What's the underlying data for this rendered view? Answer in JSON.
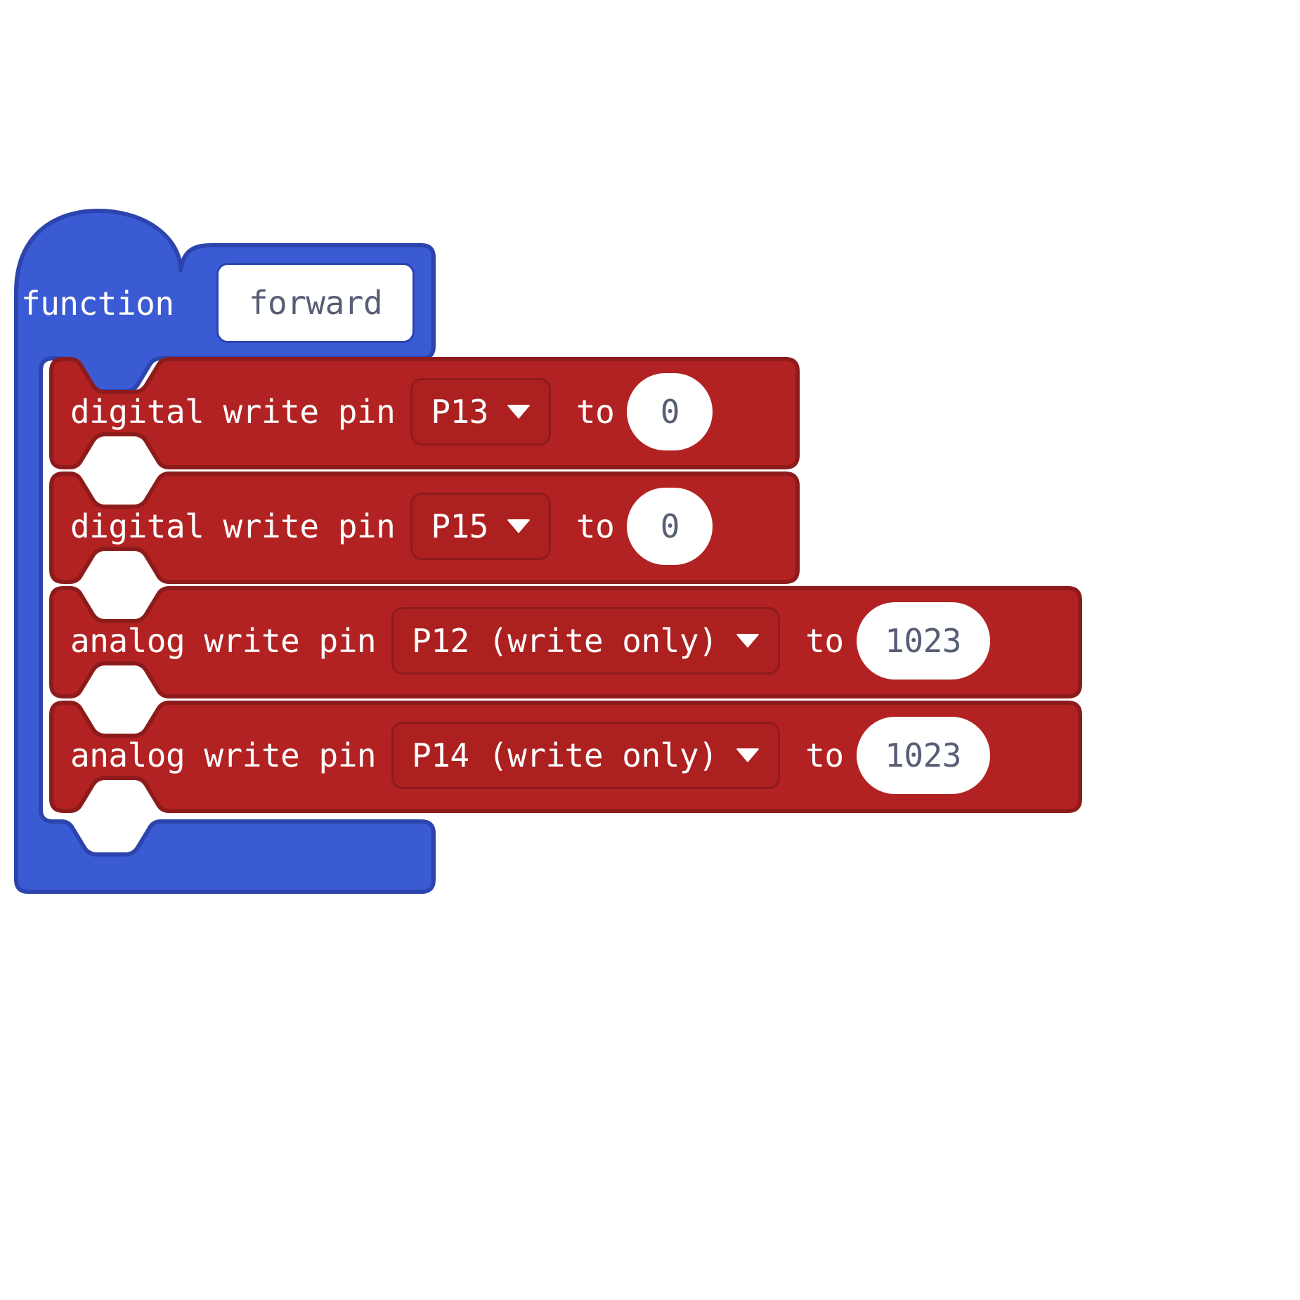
{
  "colors": {
    "function_fill": "#3b5bd4",
    "function_stroke": "#2c44ad",
    "statement_fill": "#b32222",
    "statement_stroke": "#8e1b1b",
    "field_text": "#575e75",
    "label_text": "#ffffff",
    "canvas": "#ffffff"
  },
  "function_block": {
    "keyword": "function",
    "name_field": {
      "value": "forward",
      "placeholder": "function name"
    }
  },
  "statements": [
    {
      "index": 0,
      "kind": "digital-write",
      "label": "digital write pin",
      "pin_dropdown": {
        "value": "P13",
        "caret_icon": "chevron-down-icon"
      },
      "connector": "to",
      "value_field": {
        "value": "0",
        "size": "narrow"
      }
    },
    {
      "index": 1,
      "kind": "digital-write",
      "label": "digital write pin",
      "pin_dropdown": {
        "value": "P15",
        "caret_icon": "chevron-down-icon"
      },
      "connector": "to",
      "value_field": {
        "value": "0",
        "size": "narrow"
      }
    },
    {
      "index": 2,
      "kind": "analog-write",
      "label": "analog write pin",
      "pin_dropdown": {
        "value": "P12 (write only)",
        "caret_icon": "chevron-down-icon"
      },
      "connector": "to",
      "value_field": {
        "value": "1023",
        "size": "wide"
      }
    },
    {
      "index": 3,
      "kind": "analog-write",
      "label": "analog write pin",
      "pin_dropdown": {
        "value": "P14 (write only)",
        "caret_icon": "chevron-down-icon"
      },
      "connector": "to",
      "value_field": {
        "value": "1023",
        "size": "wide"
      }
    }
  ]
}
